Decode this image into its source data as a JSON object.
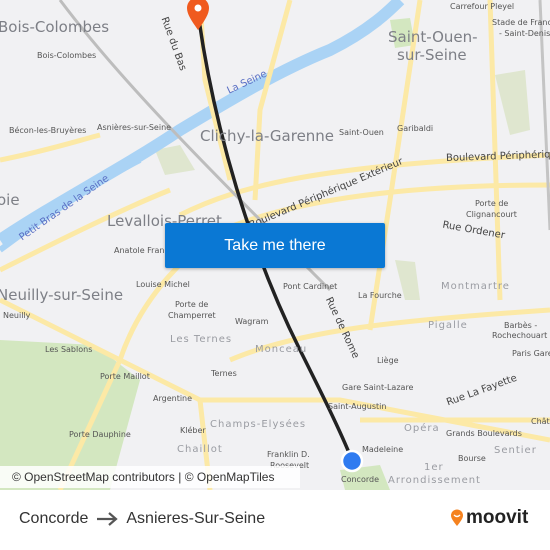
{
  "colors": {
    "route": "#222222",
    "origin": "#2f7bf0",
    "destination": "#f05a1e",
    "button": "#0a78d4",
    "river": "#aad3f5",
    "road": "#fce9a6",
    "park": "#d3e7c0"
  },
  "map": {
    "cities": [
      "Bois-Colombes",
      "Saint-Ouen-",
      "sur-Seine",
      "Clichy-la-Garenne",
      "Levallois-Perret",
      "Neuilly-sur-Seine",
      "oie"
    ],
    "districts": [
      "Montmartre",
      "Pigalle",
      "Les Ternes",
      "Monceau",
      "Champs-Elysées",
      "Chaillot",
      "Opéra",
      "Sentier",
      "1er",
      "Arrondissement"
    ],
    "places": [
      "Carrefour Pleyel",
      "Stade de France",
      "- Saint-Denis",
      "Bois-Colombes",
      "Bécon-les-Bruyères",
      "Asnières-sur-Seine",
      "Saint-Ouen",
      "Garibaldi",
      "Porte de",
      "Clignancourt",
      "Anatole France",
      "Louise Michel",
      "Neuilly",
      "Porte de",
      "Champerret",
      "Wagram",
      "Pont Cardinet",
      "La Fourche",
      "Barbès -",
      "Rochechouart",
      "Paris Gare",
      "Liège",
      "Gare Saint-Lazare",
      "Saint-Augustin",
      "Les Sablons",
      "Porte Maillot",
      "Ternes",
      "Argentine",
      "Porte Dauphine",
      "Kléber",
      "Grands Boulevards",
      "Madeleine",
      "Bourse",
      "Concorde",
      "Franklin D.",
      "Roosevelt",
      "Châte"
    ],
    "streets": [
      "Rue du Bas",
      "Boulevard Périphérique",
      "Boulevard Périphérique Extérieur",
      "Rue Ordener",
      "Rue de Rome",
      "Rue La Fayette"
    ],
    "rivers": [
      "La Seine",
      "Petit Bras de la Seine"
    ],
    "cta_label": "Take me there",
    "attribution": "© OpenStreetMap contributors | © OpenMapTiles"
  },
  "footer": {
    "origin": "Concorde",
    "destination": "Asnieres-Sur-Seine",
    "logo": "moovit"
  }
}
